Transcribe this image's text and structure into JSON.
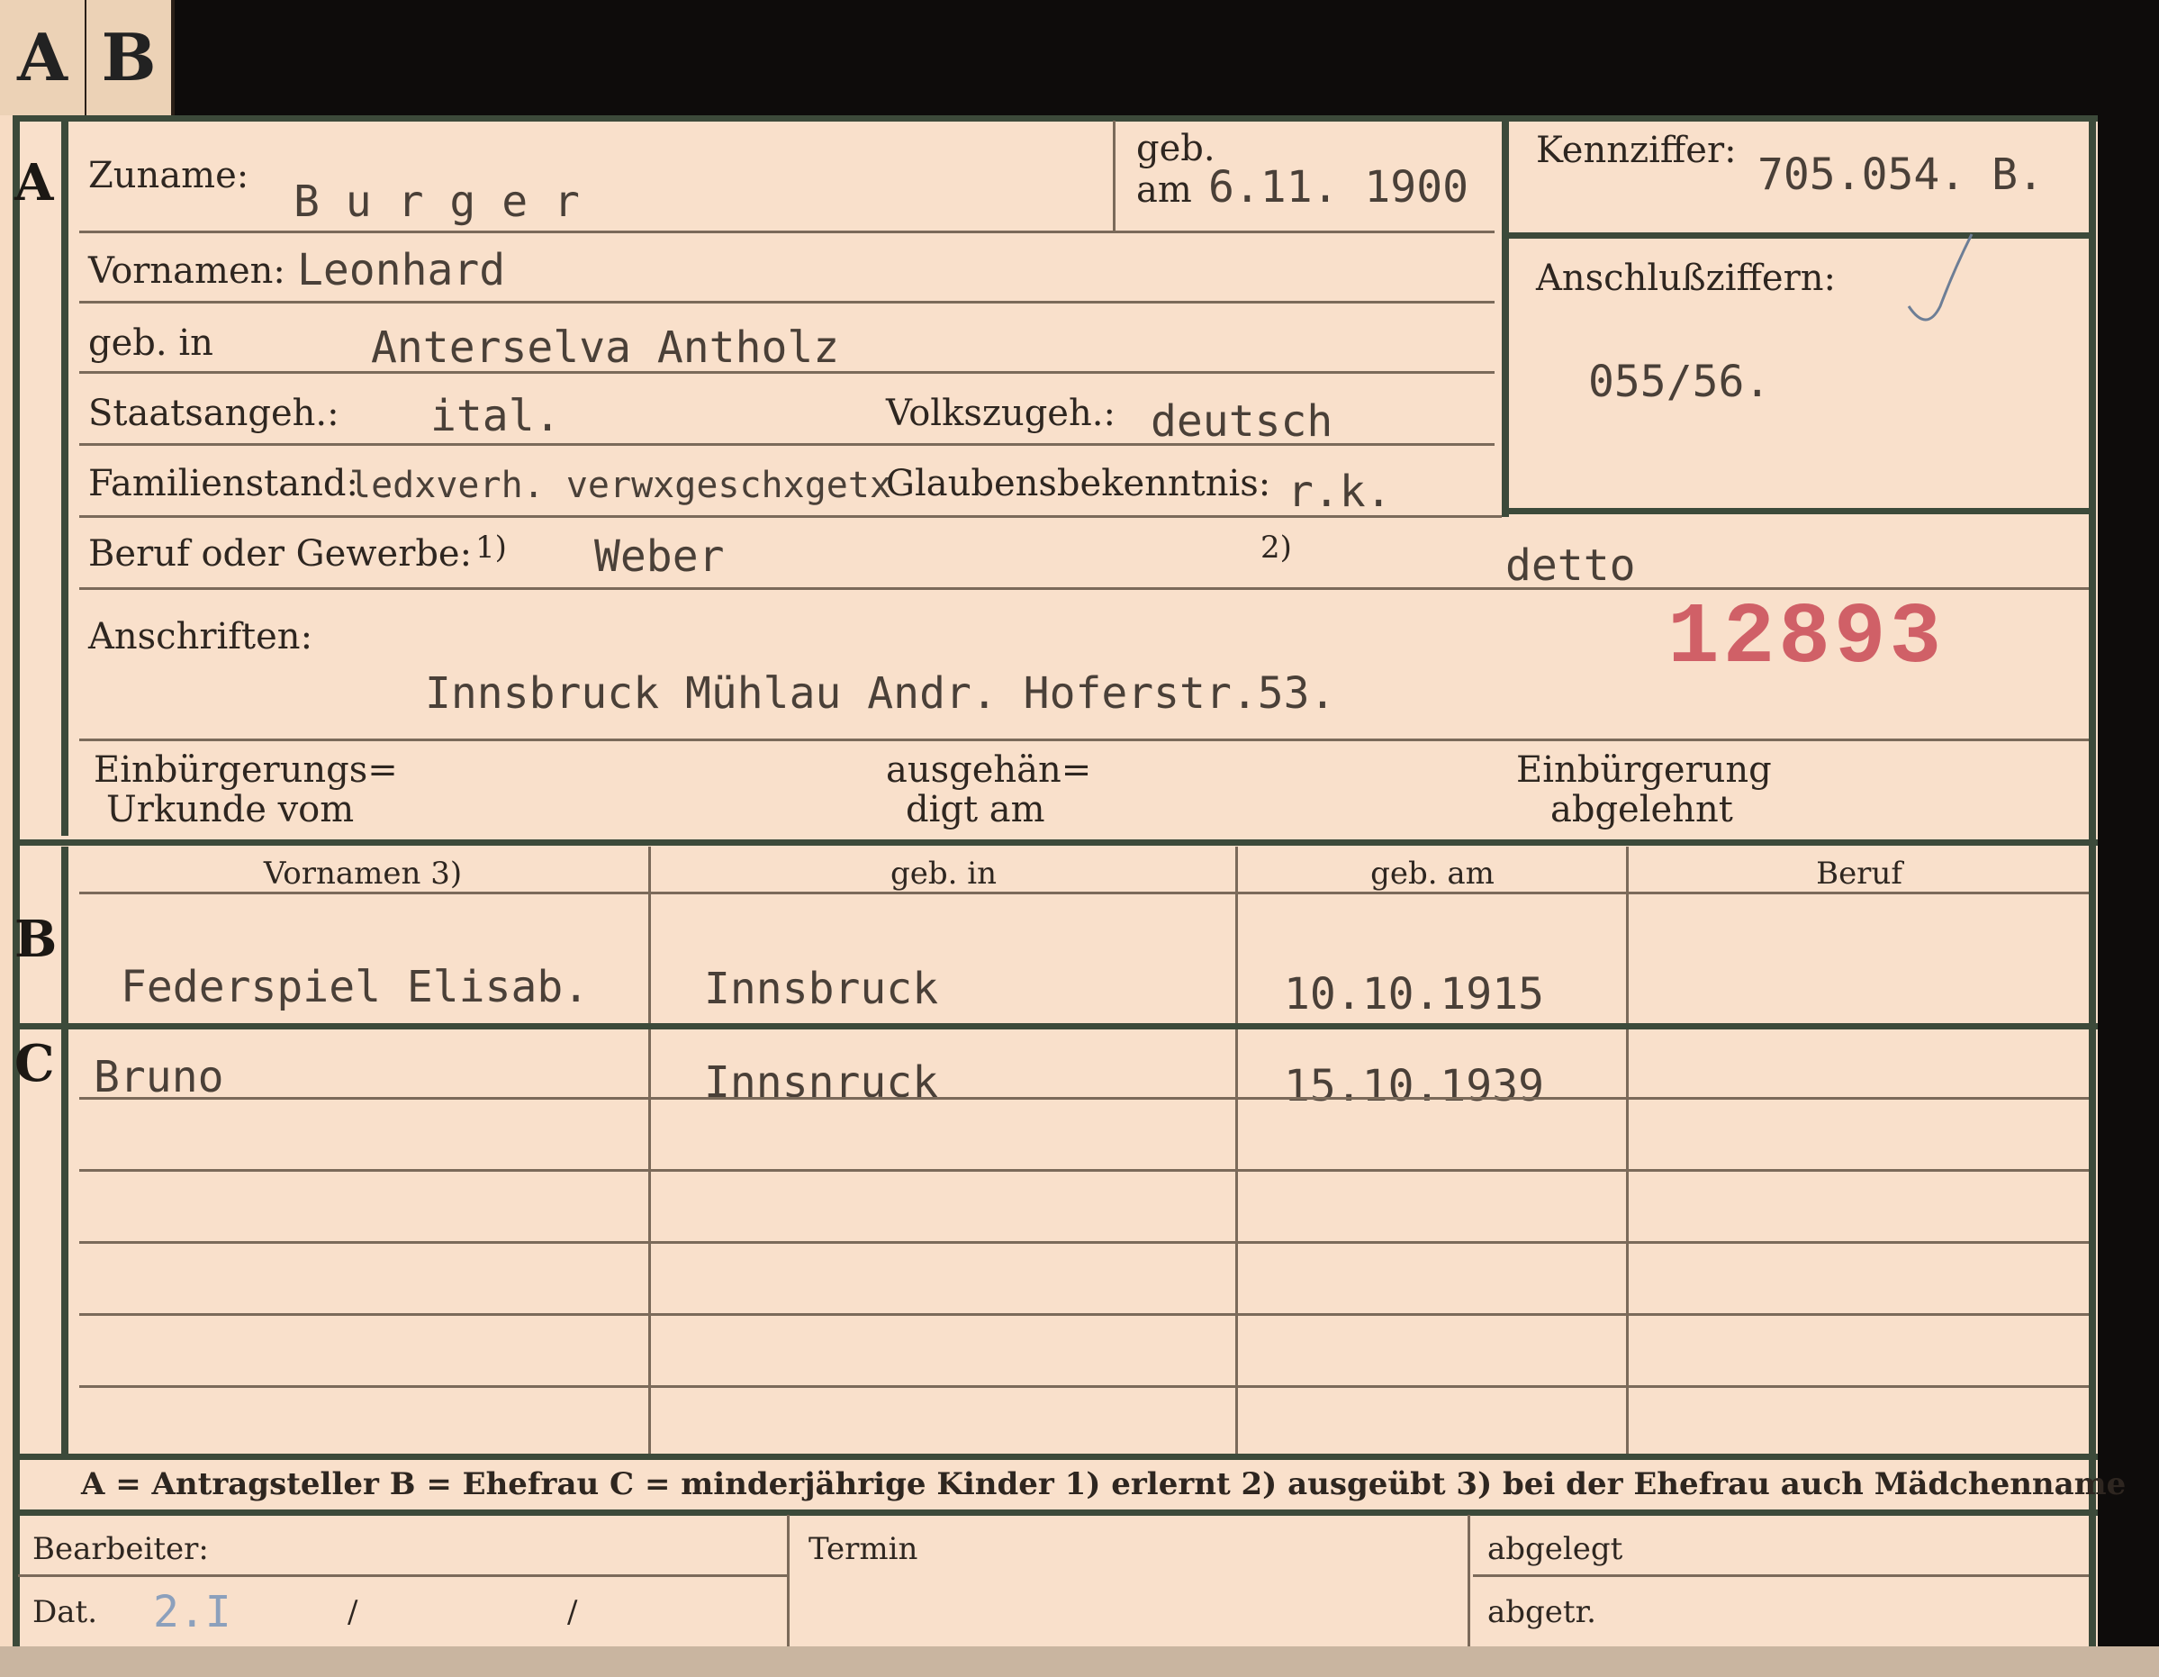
{
  "tabs": [
    "A",
    "B"
  ],
  "sections": {
    "a": "A",
    "b": "B",
    "c": "C"
  },
  "section_a": {
    "surname_label": "Zuname:",
    "surname": "B u r g e r",
    "born_label_1": "geb.",
    "born_label_2": "am",
    "birth_date": "6.11. 1900",
    "id_label": "Kennziffer:",
    "id_value": "705.054. B.",
    "firstnames_label": "Vornamen:",
    "firstnames": "Leonhard",
    "connection_label": "Anschlußziffern:",
    "connection_value": "055/56.",
    "birthplace_label": "geb. in",
    "birthplace": "Anterselva  Antholz",
    "citizenship_label": "Staatsangeh.:",
    "citizenship": "ital.",
    "ethnicity_label": "Volkszugeh.:",
    "ethnicity": "deutsch",
    "marital_label": "Familienstand:",
    "marital_value": "ledxverh. verwxgeschxgetx",
    "religion_label": "Glaubensbekenntnis:",
    "religion": "r.k.",
    "profession_label": "Beruf oder Gewerbe:",
    "profession_note1": "1)",
    "profession": "Weber",
    "profession_note2": "2)",
    "profession_practiced": "detto",
    "address_label": "Anschriften:",
    "address": "Innsbruck Mühlau Andr. Hoferstr.53.",
    "stamp_number": "12893",
    "naturalization_label_1": "Einbürgerungs=",
    "naturalization_label_2": "Urkunde vom",
    "issued_label_1": "ausgehän=",
    "issued_label_2": "digt am",
    "rejected_label_1": "Einbürgerung",
    "rejected_label_2": "abgelehnt"
  },
  "table": {
    "headers": [
      "Vornamen 3)",
      "geb. in",
      "geb. am",
      "Beruf"
    ],
    "wife": {
      "name": "Federspiel Elisab.",
      "birthplace": "Innsbruck",
      "birthdate": "10.10.1915",
      "profession": ""
    },
    "children": [
      {
        "name": "Bruno",
        "birthplace": "Innsnruck",
        "birthdate": "15.10.1939",
        "profession": ""
      }
    ]
  },
  "legend": "A = Antragsteller   B = Ehefrau   C = minderjährige Kinder   1) erlernt   2) ausgeübt   3) bei der Ehefrau auch Mädchenname",
  "footer": {
    "worker_label": "Bearbeiter:",
    "date_label": "Dat.",
    "date_value": "2.I",
    "date_sep1": "/",
    "date_sep2": "/",
    "deadline_label": "Termin",
    "filed_label": "abgelegt",
    "handed_label": "abgetr."
  },
  "colors": {
    "card": "#f9e0cb",
    "frame": "#3c4a3a",
    "stamp": "#c94a56",
    "pencil": "#8ca0bc"
  }
}
